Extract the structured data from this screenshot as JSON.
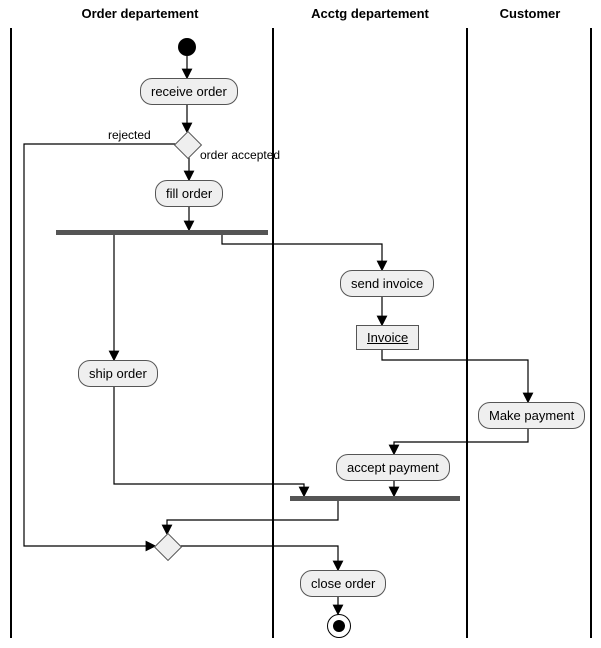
{
  "swimlanes": {
    "order": "Order departement",
    "acctg": "Acctg departement",
    "customer": "Customer"
  },
  "nodes": {
    "receive_order": "receive order",
    "fill_order": "fill order",
    "ship_order": "ship order",
    "send_invoice": "send invoice",
    "invoice": "Invoice",
    "make_payment": "Make payment",
    "accept_payment": "accept payment",
    "close_order": "close order"
  },
  "guards": {
    "rejected": "rejected",
    "accepted": "order accepted"
  },
  "chart_data": {
    "type": "uml-activity-with-swimlanes",
    "swimlanes": [
      "Order departement",
      "Acctg departement",
      "Customer"
    ],
    "initial": "start",
    "final": "end",
    "nodes": [
      {
        "id": "start",
        "kind": "initial",
        "lane": "Order departement"
      },
      {
        "id": "receive_order",
        "kind": "activity",
        "lane": "Order departement",
        "label": "receive order"
      },
      {
        "id": "decision1",
        "kind": "decision",
        "lane": "Order departement"
      },
      {
        "id": "fill_order",
        "kind": "activity",
        "lane": "Order departement",
        "label": "fill order"
      },
      {
        "id": "fork1",
        "kind": "fork",
        "lane": "Order departement"
      },
      {
        "id": "ship_order",
        "kind": "activity",
        "lane": "Order departement",
        "label": "ship order"
      },
      {
        "id": "send_invoice",
        "kind": "activity",
        "lane": "Acctg departement",
        "label": "send invoice"
      },
      {
        "id": "invoice_obj",
        "kind": "object",
        "lane": "Acctg departement",
        "label": "Invoice"
      },
      {
        "id": "make_payment",
        "kind": "activity",
        "lane": "Customer",
        "label": "Make payment"
      },
      {
        "id": "accept_payment",
        "kind": "activity",
        "lane": "Acctg departement",
        "label": "accept payment"
      },
      {
        "id": "join1",
        "kind": "join",
        "lane": "Acctg departement"
      },
      {
        "id": "merge1",
        "kind": "merge",
        "lane": "Order departement"
      },
      {
        "id": "close_order",
        "kind": "activity",
        "lane": "Acctg departement",
        "label": "close order"
      },
      {
        "id": "end",
        "kind": "final",
        "lane": "Acctg departement"
      }
    ],
    "edges": [
      {
        "from": "start",
        "to": "receive_order"
      },
      {
        "from": "receive_order",
        "to": "decision1"
      },
      {
        "from": "decision1",
        "to": "merge1",
        "guard": "rejected"
      },
      {
        "from": "decision1",
        "to": "fill_order",
        "guard": "order accepted"
      },
      {
        "from": "fill_order",
        "to": "fork1"
      },
      {
        "from": "fork1",
        "to": "ship_order"
      },
      {
        "from": "fork1",
        "to": "send_invoice"
      },
      {
        "from": "send_invoice",
        "to": "invoice_obj"
      },
      {
        "from": "invoice_obj",
        "to": "make_payment"
      },
      {
        "from": "make_payment",
        "to": "accept_payment"
      },
      {
        "from": "ship_order",
        "to": "join1"
      },
      {
        "from": "accept_payment",
        "to": "join1"
      },
      {
        "from": "join1",
        "to": "merge1"
      },
      {
        "from": "merge1",
        "to": "close_order"
      },
      {
        "from": "close_order",
        "to": "end"
      }
    ]
  }
}
